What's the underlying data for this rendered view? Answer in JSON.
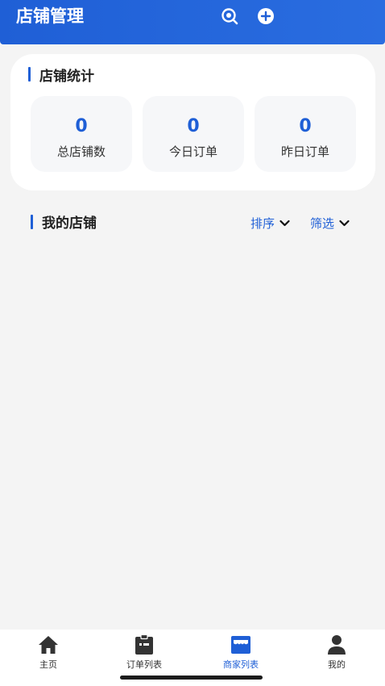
{
  "header": {
    "title": "店铺管理",
    "icons": [
      "search-icon",
      "add-icon"
    ]
  },
  "stats": {
    "title": "店铺统计",
    "items": [
      {
        "value": "0",
        "label": "总店铺数"
      },
      {
        "value": "0",
        "label": "今日订单"
      },
      {
        "value": "0",
        "label": "昨日订单"
      }
    ]
  },
  "my_stores": {
    "title": "我的店铺",
    "sort_label": "排序",
    "filter_label": "筛选"
  },
  "tabbar": {
    "items": [
      {
        "label": "主页",
        "icon": "home-icon"
      },
      {
        "label": "订单列表",
        "icon": "clipboard-icon"
      },
      {
        "label": "商家列表",
        "icon": "store-icon",
        "active": true
      },
      {
        "label": "我的",
        "icon": "user-icon"
      }
    ]
  },
  "colors": {
    "accent": "#1f5fd6",
    "background": "#f4f4f4"
  }
}
